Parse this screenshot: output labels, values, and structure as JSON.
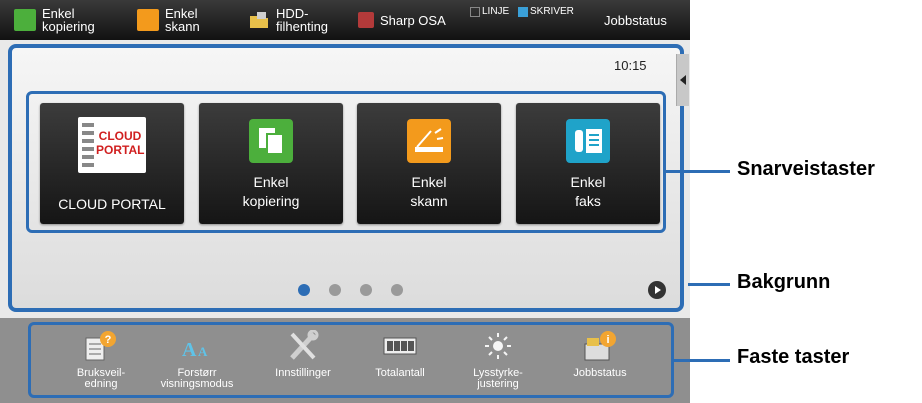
{
  "topbar": {
    "items": [
      {
        "label": "Enkel\nkopiering",
        "icon": "copy-icon"
      },
      {
        "label": "Enkel\nskann",
        "icon": "scan-icon"
      },
      {
        "label": "HDD-\nfilhenting",
        "icon": "folder-icon"
      },
      {
        "label": "Sharp OSA",
        "icon": "osa-icon"
      }
    ],
    "indicators": {
      "line": "LINJE",
      "printer": "SKRIVER"
    },
    "jobstatus": "Jobbstatus"
  },
  "main": {
    "time": "10:15",
    "shortcuts": [
      {
        "label": "CLOUD PORTAL",
        "icon_text": "CLOUD\nPORTAL",
        "icon": "cloud-portal-icon"
      },
      {
        "label": "Enkel\nkopiering",
        "icon": "copy-icon"
      },
      {
        "label": "Enkel\nskann",
        "icon": "scan-icon"
      },
      {
        "label": "Enkel\nfaks",
        "icon": "fax-icon"
      }
    ],
    "pages": {
      "count": 4,
      "current": 1
    }
  },
  "fixed_keys": [
    {
      "label": "Bruksveil-\nedning",
      "icon": "manual-icon"
    },
    {
      "label": "Forstørr\nvisningsmodus",
      "icon": "enlarge-display-icon"
    },
    {
      "label": "Innstillinger",
      "icon": "settings-icon"
    },
    {
      "label": "Totalantall",
      "icon": "counter-icon"
    },
    {
      "label": "Lysstyrke-\njustering",
      "icon": "brightness-icon"
    },
    {
      "label": "Jobbstatus",
      "icon": "job-status-icon"
    }
  ],
  "callouts": {
    "shortcut_keys": "Snarveistaster",
    "background": "Bakgrunn",
    "fixed_keys": "Faste taster"
  },
  "colors": {
    "accent": "#2d6db5",
    "green": "#4caf3c",
    "orange": "#f39a1c",
    "teal": "#1fa3c9"
  }
}
